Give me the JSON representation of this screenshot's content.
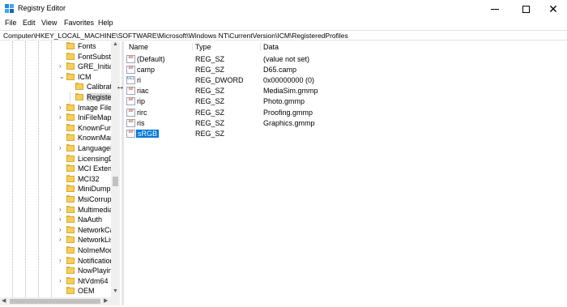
{
  "window": {
    "title": "Registry Editor",
    "icon": "registry-editor-icon"
  },
  "menu": [
    "File",
    "Edit",
    "View",
    "Favorites",
    "Help"
  ],
  "address": "Computer\\HKEY_LOCAL_MACHINE\\SOFTWARE\\Microsoft\\Windows NT\\CurrentVersion\\ICM\\RegisteredProfiles",
  "tree": {
    "items": [
      {
        "label": "Fonts",
        "chevron": ""
      },
      {
        "label": "FontSubstit",
        "chevron": ""
      },
      {
        "label": "GRE_Initiali",
        "chevron": "›"
      },
      {
        "label": "ICM",
        "chevron": "⌄"
      },
      {
        "label": "Calibrati",
        "chevron": ""
      },
      {
        "label": "Register",
        "chevron": ""
      },
      {
        "label": "Image File I",
        "chevron": "›"
      },
      {
        "label": "IniFileMapp",
        "chevron": "›"
      },
      {
        "label": "KnownFun",
        "chevron": ""
      },
      {
        "label": "KnownMar",
        "chevron": ""
      },
      {
        "label": "LanguageP",
        "chevron": "›"
      },
      {
        "label": "LicensingD",
        "chevron": ""
      },
      {
        "label": "MCI Extens",
        "chevron": ""
      },
      {
        "label": "MCI32",
        "chevron": ""
      },
      {
        "label": "MiniDump",
        "chevron": ""
      },
      {
        "label": "MsiCorrupt",
        "chevron": ""
      },
      {
        "label": "Multimedia",
        "chevron": "›"
      },
      {
        "label": "NaAuth",
        "chevron": "›"
      },
      {
        "label": "NetworkCa",
        "chevron": "›"
      },
      {
        "label": "NetworkLis",
        "chevron": "›"
      },
      {
        "label": "NoImeMoo",
        "chevron": ""
      },
      {
        "label": "Notification",
        "chevron": "›"
      },
      {
        "label": "NowPlaying",
        "chevron": ""
      },
      {
        "label": "NtVdm64",
        "chevron": "›"
      },
      {
        "label": "OEM",
        "chevron": ""
      }
    ]
  },
  "values": {
    "headers": {
      "name": "Name",
      "type": "Type",
      "data": "Data"
    },
    "rows": [
      {
        "name": "(Default)",
        "type": "REG_SZ",
        "data": "(value not set)",
        "icon": "ab"
      },
      {
        "name": "camp",
        "type": "REG_SZ",
        "data": "D65.camp",
        "icon": "ab"
      },
      {
        "name": "ri",
        "type": "REG_DWORD",
        "data": "0x00000000 (0)",
        "icon": "011"
      },
      {
        "name": "riac",
        "type": "REG_SZ",
        "data": "MediaSim.gmmp",
        "icon": "ab"
      },
      {
        "name": "rip",
        "type": "REG_SZ",
        "data": "Photo.gmmp",
        "icon": "ab"
      },
      {
        "name": "rirc",
        "type": "REG_SZ",
        "data": "Proofing.gmmp",
        "icon": "ab"
      },
      {
        "name": "ris",
        "type": "REG_SZ",
        "data": "Graphics.gmmp",
        "icon": "ab"
      },
      {
        "name": "sRGB",
        "type": "REG_SZ",
        "data": "",
        "icon": "ab"
      }
    ]
  },
  "colors": {
    "selection": "#0078d7",
    "folder": "#f6cf5a"
  }
}
